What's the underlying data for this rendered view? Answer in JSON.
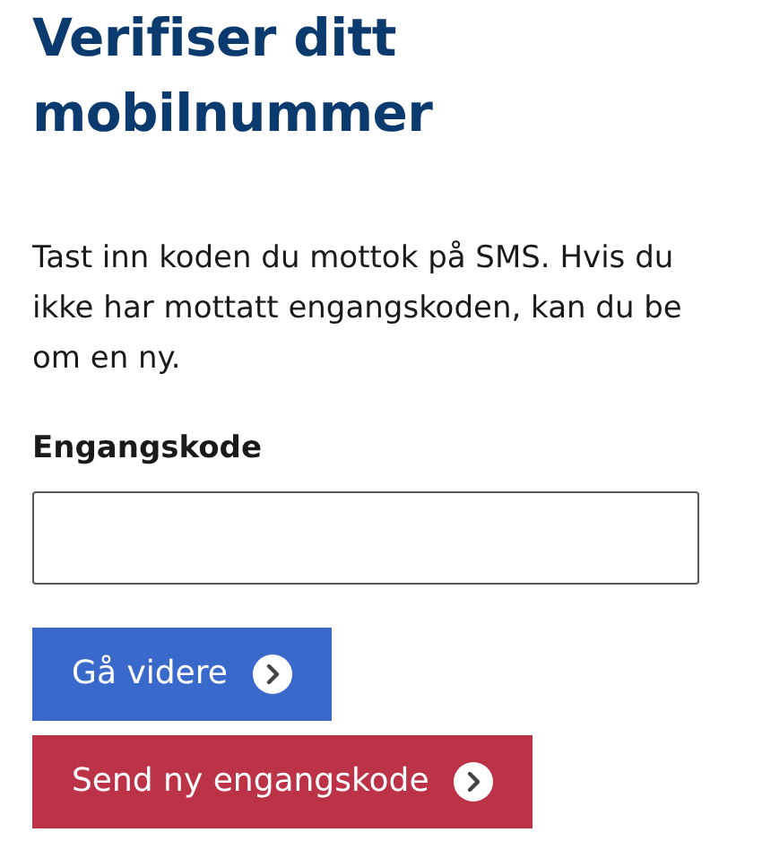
{
  "heading": "Verifiser ditt mobilnummer",
  "intro": "Tast inn koden du mottok på SMS. Hvis du ikke har mottatt engangskoden, kan du be om en ny.",
  "code_field": {
    "label": "Engangskode"
  },
  "buttons": [
    {
      "label": "Gå videre",
      "kind": "primary"
    },
    {
      "label": "Send ny engangskode",
      "kind": "danger"
    }
  ]
}
